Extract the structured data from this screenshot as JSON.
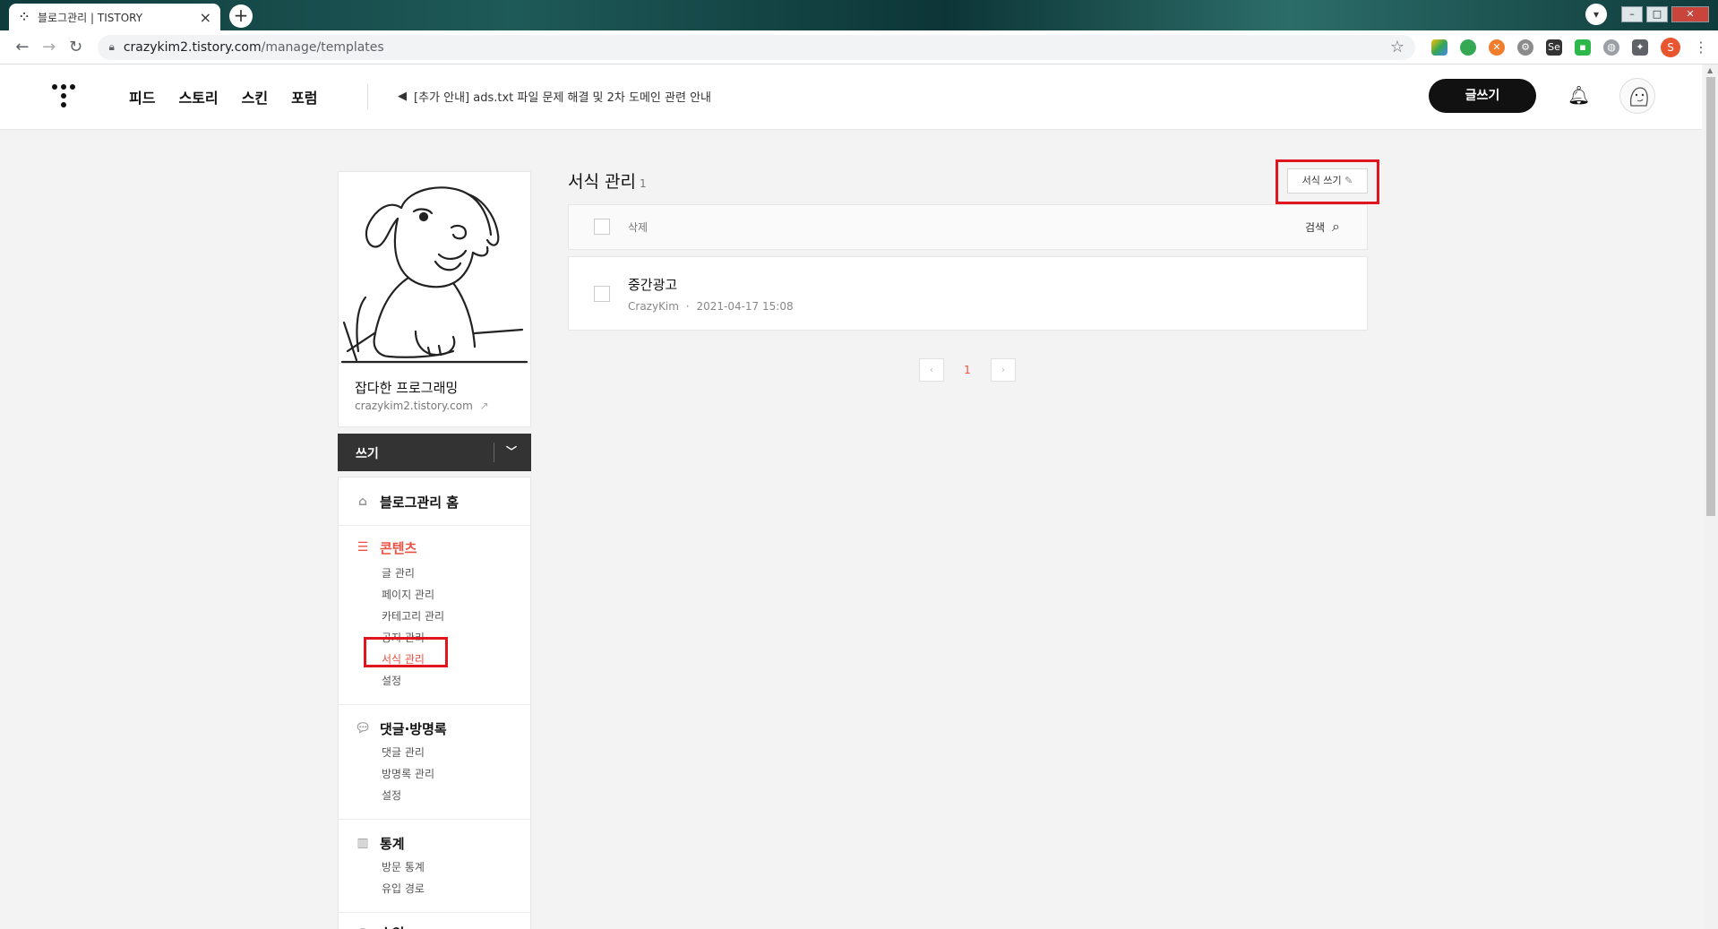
{
  "browser": {
    "tab_title": "블로그관리 | TISTORY",
    "tab_close": "×",
    "new_tab": "+",
    "url_host": "crazykim2.tistory.com",
    "url_path": "/manage/templates",
    "profile_initial": "S"
  },
  "header": {
    "nav": [
      "피드",
      "스토리",
      "스킨",
      "포럼"
    ],
    "notice": "[추가 안내] ads.txt 파일 문제 해결 및 2차 도메인 관련 안내",
    "write_label": "글쓰기"
  },
  "sidebar": {
    "blog_name": "잡다한 프로그래밍",
    "blog_url": "crazykim2.tistory.com",
    "write_dropdown": "쓰기",
    "home_label": "블로그관리 홈",
    "content": {
      "label": "콘텐츠",
      "items": [
        "글 관리",
        "페이지 관리",
        "카테고리 관리",
        "공지 관리",
        "서식 관리",
        "설정"
      ]
    },
    "comments": {
      "label": "댓글·방명록",
      "items": [
        "댓글 관리",
        "방명록 관리",
        "설정"
      ]
    },
    "stats": {
      "label": "통계",
      "items": [
        "방문 통계",
        "유입 경로"
      ]
    },
    "revenue": {
      "label": "수익"
    }
  },
  "main": {
    "title": "서식 관리",
    "count": "1",
    "write_template": "서식 쓰기",
    "delete_label": "삭제",
    "search_label": "검색",
    "rows": [
      {
        "title": "중간광고",
        "author": "CrazyKim",
        "date": "2021-04-17 15:08"
      }
    ],
    "pager": {
      "current": "1",
      "prev": "‹",
      "next": "›"
    }
  },
  "colors": {
    "accent": "#ec5041",
    "highlight_box": "#e0161e",
    "dark_button": "#111111"
  }
}
